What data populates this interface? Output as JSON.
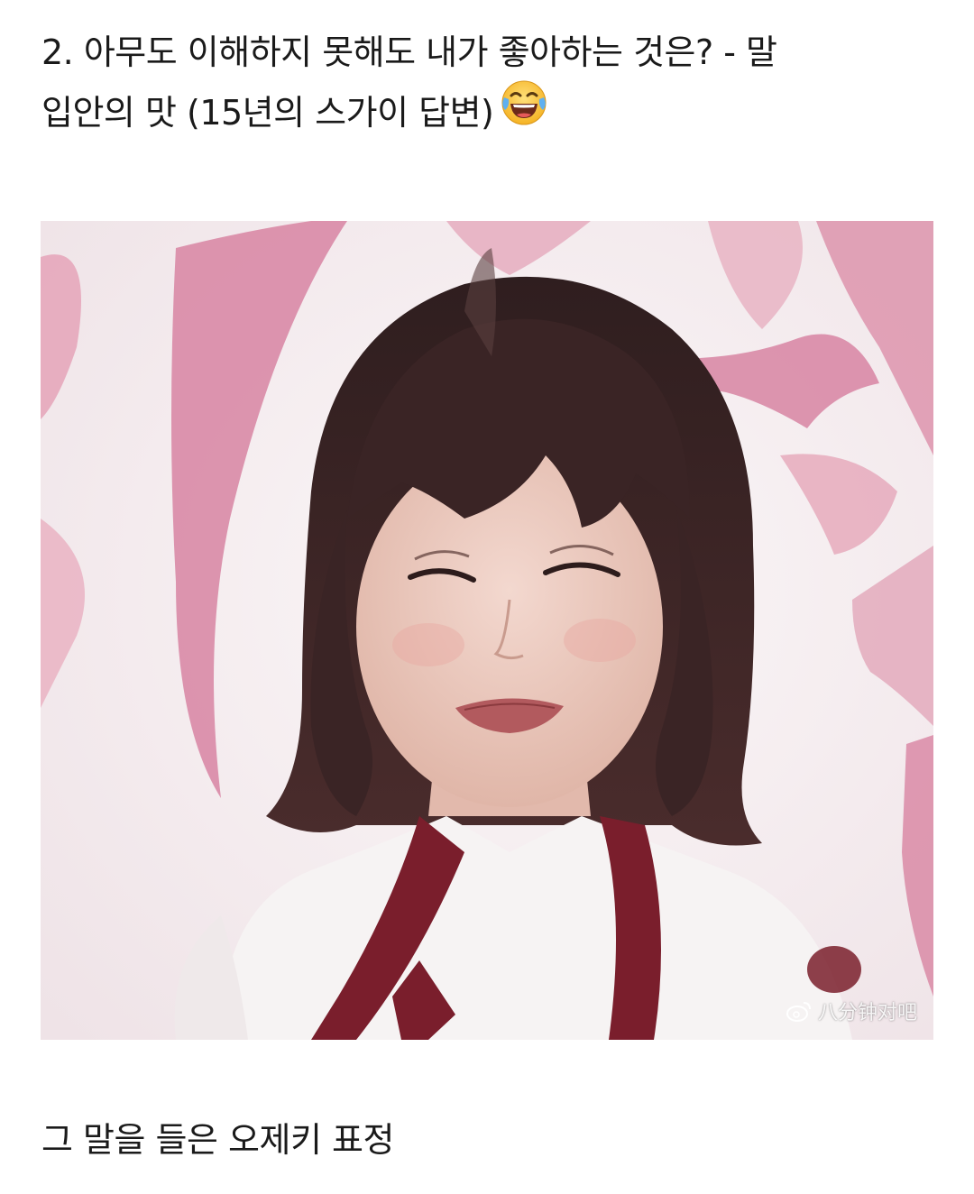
{
  "post": {
    "heading_line1": "2. 아무도 이해하지 못해도 내가 좋아하는 것은? - 말",
    "heading_line2": "입안의 맛 (15년의 스가이 답변)",
    "heading_emoji": "face-with-tears-of-joy-icon",
    "photo": {
      "watermark_text": "八分钟对吧",
      "watermark_icon": "weibo-icon"
    },
    "caption": "그 말을 들은 오제키 표정"
  },
  "colors": {
    "background": "#ffffff",
    "text": "#1a1a1a",
    "photo_pink": "#d98aa6",
    "hair": "#3b2526",
    "scarf": "#7a1e2c"
  }
}
